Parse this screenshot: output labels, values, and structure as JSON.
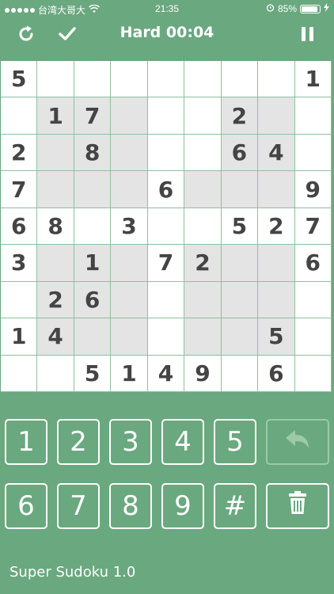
{
  "status_bar": {
    "carrier": "台湾大哥大",
    "time": "21:35",
    "battery": "85%"
  },
  "header": {
    "title": "Hard 00:04",
    "refresh_icon": "refresh-icon",
    "check_icon": "check-icon",
    "pause_icon": "pause-icon"
  },
  "board": {
    "rows": [
      [
        "5",
        "",
        "",
        "",
        "",
        "",
        "",
        "",
        "1"
      ],
      [
        "",
        "1",
        "7",
        "",
        "",
        "",
        "2",
        "",
        ""
      ],
      [
        "2",
        "",
        "8",
        "",
        "",
        "",
        "6",
        "4",
        ""
      ],
      [
        "7",
        "",
        "",
        "",
        "6",
        "",
        "",
        "",
        "9"
      ],
      [
        "6",
        "8",
        "",
        "3",
        "",
        "",
        "5",
        "2",
        "7"
      ],
      [
        "3",
        "",
        "1",
        "",
        "7",
        "2",
        "",
        "",
        "6"
      ],
      [
        "",
        "2",
        "6",
        "",
        "",
        "",
        "",
        "",
        ""
      ],
      [
        "1",
        "4",
        "",
        "",
        "",
        "",
        "",
        "5",
        ""
      ],
      [
        "",
        "",
        "5",
        "1",
        "4",
        "9",
        "",
        "6",
        ""
      ]
    ],
    "shaded": [
      [
        1,
        1
      ],
      [
        1,
        2
      ],
      [
        1,
        3
      ],
      [
        1,
        6
      ],
      [
        1,
        7
      ],
      [
        2,
        1
      ],
      [
        2,
        2
      ],
      [
        2,
        3
      ],
      [
        2,
        6
      ],
      [
        2,
        7
      ],
      [
        3,
        1
      ],
      [
        3,
        2
      ],
      [
        3,
        3
      ],
      [
        3,
        5
      ],
      [
        3,
        6
      ],
      [
        3,
        7
      ],
      [
        5,
        1
      ],
      [
        5,
        2
      ],
      [
        5,
        3
      ],
      [
        5,
        5
      ],
      [
        5,
        6
      ],
      [
        5,
        7
      ],
      [
        6,
        1
      ],
      [
        6,
        2
      ],
      [
        6,
        3
      ],
      [
        6,
        5
      ],
      [
        6,
        6
      ],
      [
        6,
        7
      ],
      [
        7,
        1
      ],
      [
        7,
        2
      ],
      [
        7,
        3
      ],
      [
        7,
        5
      ],
      [
        7,
        6
      ],
      [
        7,
        7
      ]
    ]
  },
  "keypad": {
    "row1": [
      "1",
      "2",
      "3",
      "4",
      "5"
    ],
    "row2": [
      "6",
      "7",
      "8",
      "9",
      "#"
    ],
    "undo_icon": "undo-icon",
    "delete_icon": "trash-icon"
  },
  "footer": {
    "label": "Super Sudoku 1.0"
  }
}
